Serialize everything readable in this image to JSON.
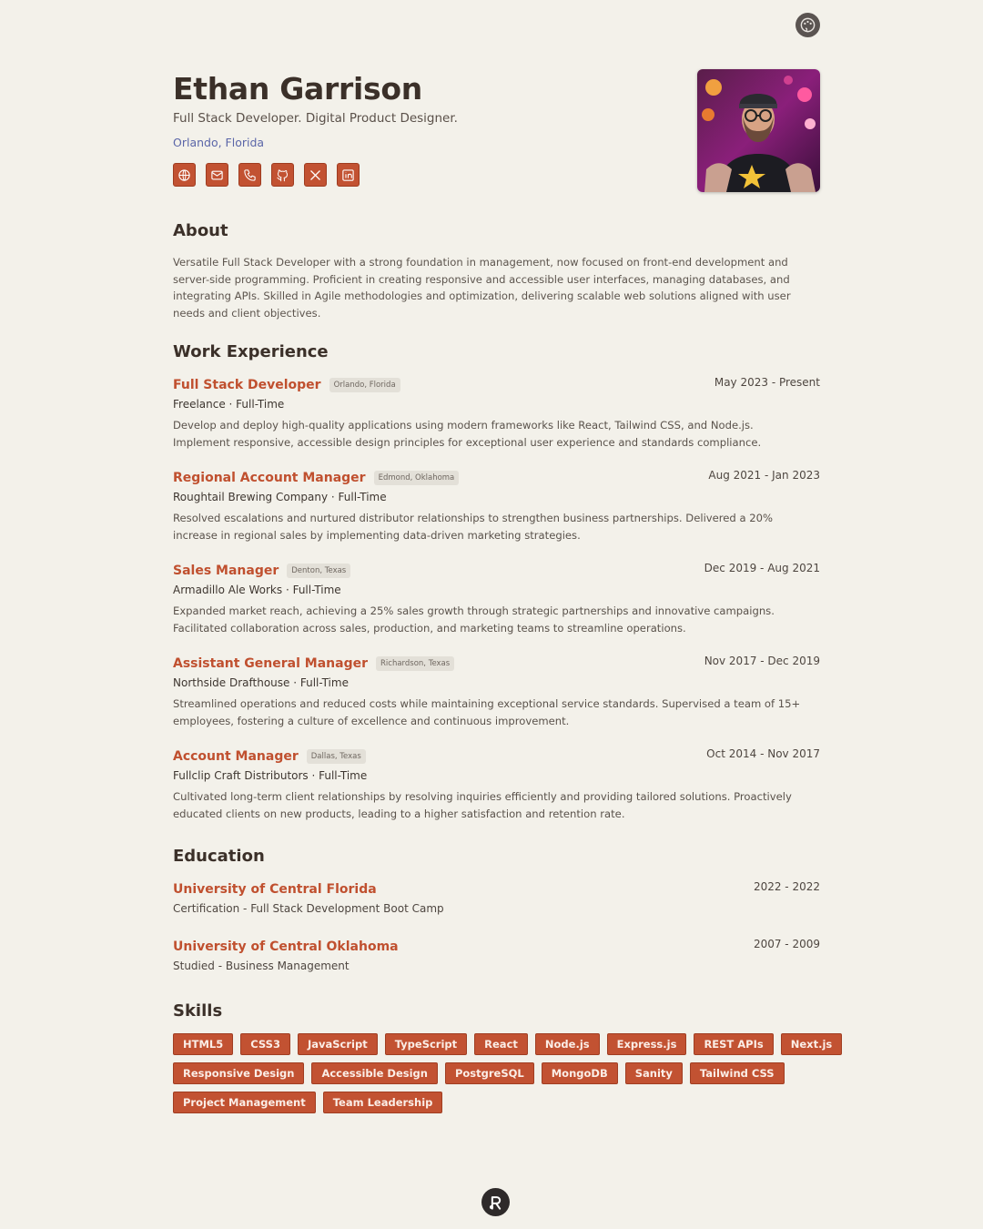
{
  "header": {
    "name": "Ethan Garrison",
    "headline": "Full Stack Developer. Digital Product Designer.",
    "location": "Orlando, Florida",
    "contact_icons": [
      "globe-icon",
      "mail-icon",
      "phone-icon",
      "github-icon",
      "x-icon",
      "linkedin-icon"
    ]
  },
  "about": {
    "title": "About",
    "text": "Versatile Full Stack Developer with a strong foundation in management, now focused on front-end development and server-side programming. Proficient in creating responsive and accessible user interfaces, managing databases, and integrating APIs. Skilled in Agile methodologies and optimization, delivering scalable web solutions aligned with user needs and client objectives."
  },
  "work": {
    "title": "Work Experience",
    "jobs": [
      {
        "title": "Full Stack Developer",
        "location": "Orlando, Florida",
        "dates": "May 2023 - Present",
        "company": "Freelance · Full-Time",
        "description": "Develop and deploy high-quality applications using modern frameworks like React, Tailwind CSS, and Node.js. Implement responsive, accessible design principles for exceptional user experience and standards compliance."
      },
      {
        "title": "Regional Account Manager",
        "location": "Edmond, Oklahoma",
        "dates": "Aug 2021 - Jan 2023",
        "company": "Roughtail Brewing Company · Full-Time",
        "description": "Resolved escalations and nurtured distributor relationships to strengthen business partnerships. Delivered a 20% increase in regional sales by implementing data-driven marketing strategies."
      },
      {
        "title": "Sales Manager",
        "location": "Denton, Texas",
        "dates": "Dec 2019 - Aug 2021",
        "company": "Armadillo Ale Works · Full-Time",
        "description": "Expanded market reach, achieving a 25% sales growth through strategic partnerships and innovative campaigns. Facilitated collaboration across sales, production, and marketing teams to streamline operations."
      },
      {
        "title": "Assistant General Manager",
        "location": "Richardson, Texas",
        "dates": "Nov 2017 - Dec 2019",
        "company": "Northside Drafthouse · Full-Time",
        "description": "Streamlined operations and reduced costs while maintaining exceptional service standards. Supervised a team of 15+ employees, fostering a culture of excellence and continuous improvement."
      },
      {
        "title": "Account Manager",
        "location": "Dallas, Texas",
        "dates": "Oct 2014 - Nov 2017",
        "company": "Fullclip Craft Distributors · Full-Time",
        "description": "Cultivated long-term client relationships by resolving inquiries efficiently and providing tailored solutions. Proactively educated clients on new products, leading to a higher satisfaction and retention rate."
      }
    ]
  },
  "education": {
    "title": "Education",
    "items": [
      {
        "school": "University of Central Florida",
        "dates": "2022 - 2022",
        "detail": "Certification - Full Stack Development Boot Camp"
      },
      {
        "school": "University of Central Oklahoma",
        "dates": "2007 - 2009",
        "detail": "Studied - Business Management"
      }
    ]
  },
  "skills": {
    "title": "Skills",
    "rows": [
      [
        "HTML5",
        "CSS3",
        "JavaScript",
        "TypeScript",
        "React",
        "Node.js",
        "Express.js",
        "REST APIs",
        "Next.js"
      ],
      [
        "Responsive Design",
        "Accessible Design",
        "PostgreSQL",
        "MongoDB",
        "Sanity",
        "Tailwind CSS"
      ],
      [
        "Project Management",
        "Team Leadership"
      ]
    ]
  },
  "colors": {
    "background": "#f3f1ea",
    "accent": "#c25232",
    "link": "#5b66a8"
  }
}
